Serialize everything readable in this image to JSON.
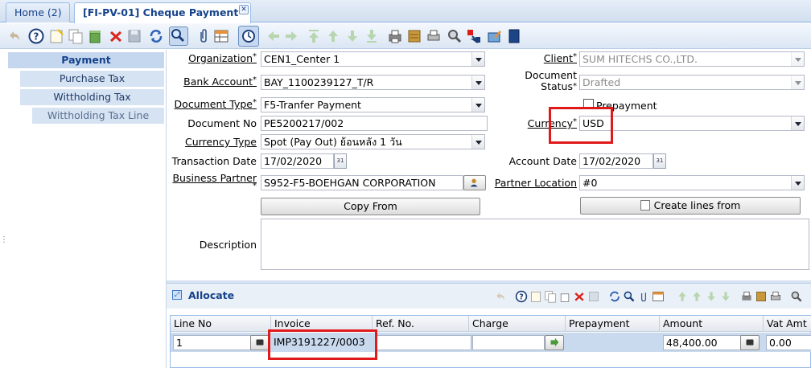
{
  "tabs": [
    {
      "label": "Home (2)"
    },
    {
      "label": "[FI-PV-01] Cheque Payment"
    }
  ],
  "sidebar": {
    "items": [
      {
        "label": "Payment"
      },
      {
        "label": "Purchase Tax"
      },
      {
        "label": "Wittholding Tax"
      },
      {
        "label": "Wittholding Tax Line"
      }
    ]
  },
  "form": {
    "organization": {
      "label": "Organization",
      "value": "CEN1_Center 1"
    },
    "bank_account": {
      "label": "Bank Account",
      "value": "BAY_1100239127_T/R"
    },
    "document_type": {
      "label": "Document Type",
      "value": "F5-Tranfer Payment"
    },
    "document_no": {
      "label": "Document No",
      "value": "PE5200217/002"
    },
    "currency_type": {
      "label": "Currency Type",
      "value": "Spot (Pay Out) ย้อนหลัง 1 วัน"
    },
    "transaction_date": {
      "label": "Transaction Date",
      "value": "17/02/2020"
    },
    "business_partner": {
      "label": "Business Partner",
      "value": "S952-F5-BOEHGAN CORPORATION"
    },
    "client": {
      "label": "Client",
      "value": "SUM HITECHS CO.,LTD."
    },
    "document_status": {
      "label_line1": "Document",
      "label_line2": "Status",
      "value": "Drafted"
    },
    "prepayment": {
      "label": "Prepayment",
      "checked": false
    },
    "currency": {
      "label": "Currency",
      "value": "USD"
    },
    "account_date": {
      "label": "Account Date",
      "value": "17/02/2020"
    },
    "partner_location": {
      "label": "Partner Location",
      "value": "#0"
    },
    "copy_from_label": "Copy From",
    "create_lines_label": "Create lines from",
    "description": {
      "label": "Description",
      "value": ""
    },
    "required_mark": "*"
  },
  "allocate": {
    "title": "Allocate",
    "columns": [
      "Line No",
      "Invoice",
      "Ref. No.",
      "Charge",
      "Prepayment",
      "Amount",
      "Vat Amt"
    ],
    "rows": [
      {
        "line_no": "1",
        "invoice": "IMP3191227/0003",
        "ref_no": "",
        "charge": "",
        "prepayment": "",
        "amount": "48,400.00",
        "vat_amt": "0.00"
      }
    ]
  },
  "colors": {
    "accent": "#15428b",
    "highlight": "#e0191b",
    "selected_row": "#c9d9ee"
  }
}
